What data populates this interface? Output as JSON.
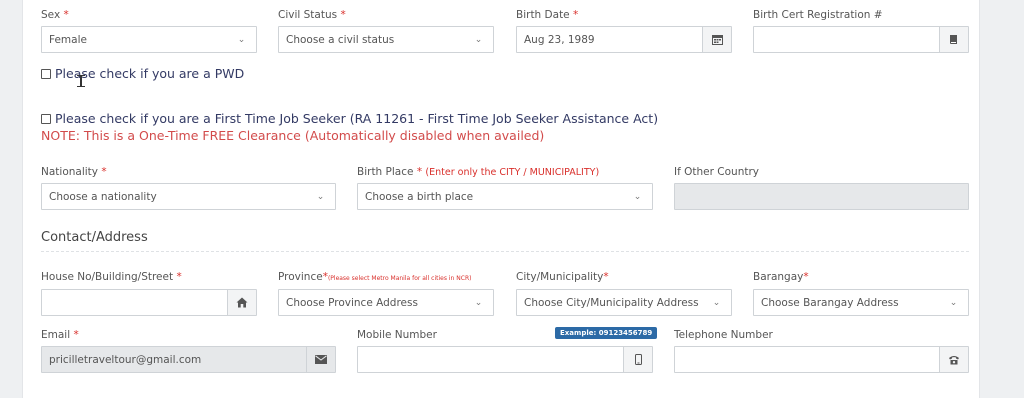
{
  "personal": {
    "sex": {
      "label": "Sex",
      "value": "Female"
    },
    "civil_status": {
      "label": "Civil Status",
      "placeholder": "Choose a civil status"
    },
    "birth_date": {
      "label": "Birth Date",
      "value": "Aug 23, 1989"
    },
    "birth_cert": {
      "label": "Birth Cert Registration #",
      "value": ""
    },
    "pwd_label": "Please check if you are a PWD",
    "first_time_label": "Please check if you are a First Time Job Seeker (RA 11261 - First Time Job Seeker Assistance Act)",
    "note": "NOTE: This is a One-Time FREE Clearance (Automatically disabled when availed)",
    "nationality": {
      "label": "Nationality",
      "placeholder": "Choose a nationality"
    },
    "birth_place": {
      "label": "Birth Place",
      "hint": "(Enter only the CITY / MUNICIPALITY)",
      "placeholder": "Choose a birth place"
    },
    "other_country": {
      "label": "If Other Country",
      "value": ""
    }
  },
  "contact": {
    "section_title": "Contact/Address",
    "house": {
      "label": "House No/Building/Street",
      "value": ""
    },
    "province": {
      "label": "Province",
      "hint": "(Please select Metro Manila for all cities in NCR)",
      "placeholder": "Choose Province Address"
    },
    "city": {
      "label": "City/Municipality",
      "placeholder": "Choose City/Municipality Address"
    },
    "barangay": {
      "label": "Barangay",
      "placeholder": "Choose Barangay Address"
    },
    "email": {
      "label": "Email",
      "value": "pricilletraveltour@gmail.com"
    },
    "mobile": {
      "label": "Mobile Number",
      "example": "Example: 09123456789",
      "value": ""
    },
    "telephone": {
      "label": "Telephone Number",
      "value": ""
    }
  },
  "required_mark": "*",
  "icons": {
    "dropdown": "chevron-down-icon",
    "calendar": "calendar-icon",
    "book": "book-icon",
    "home": "home-icon",
    "envelope": "envelope-icon",
    "mobile": "mobile-phone-icon",
    "phone": "telephone-icon"
  },
  "colors": {
    "required": "#d9302c",
    "note": "#d24b4b",
    "badge": "#2c6aa6",
    "checkbox_text": "#333a64"
  }
}
